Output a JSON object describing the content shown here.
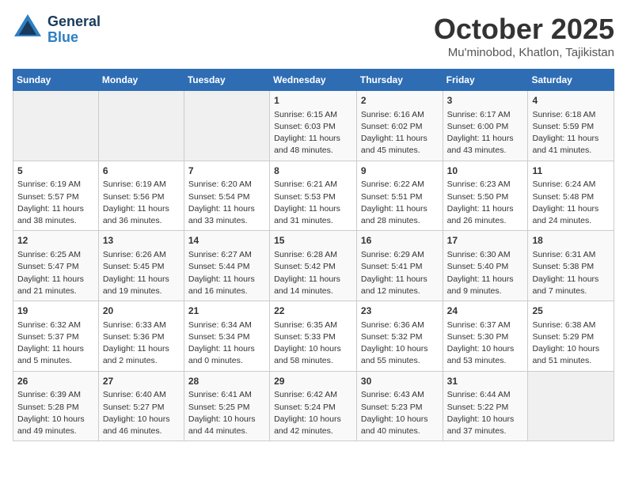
{
  "header": {
    "logo_line1": "General",
    "logo_line2": "Blue",
    "month": "October 2025",
    "location": "Mu'minobod, Khatlon, Tajikistan"
  },
  "days_of_week": [
    "Sunday",
    "Monday",
    "Tuesday",
    "Wednesday",
    "Thursday",
    "Friday",
    "Saturday"
  ],
  "weeks": [
    [
      {
        "day": "",
        "info": ""
      },
      {
        "day": "",
        "info": ""
      },
      {
        "day": "",
        "info": ""
      },
      {
        "day": "1",
        "info": "Sunrise: 6:15 AM\nSunset: 6:03 PM\nDaylight: 11 hours and 48 minutes."
      },
      {
        "day": "2",
        "info": "Sunrise: 6:16 AM\nSunset: 6:02 PM\nDaylight: 11 hours and 45 minutes."
      },
      {
        "day": "3",
        "info": "Sunrise: 6:17 AM\nSunset: 6:00 PM\nDaylight: 11 hours and 43 minutes."
      },
      {
        "day": "4",
        "info": "Sunrise: 6:18 AM\nSunset: 5:59 PM\nDaylight: 11 hours and 41 minutes."
      }
    ],
    [
      {
        "day": "5",
        "info": "Sunrise: 6:19 AM\nSunset: 5:57 PM\nDaylight: 11 hours and 38 minutes."
      },
      {
        "day": "6",
        "info": "Sunrise: 6:19 AM\nSunset: 5:56 PM\nDaylight: 11 hours and 36 minutes."
      },
      {
        "day": "7",
        "info": "Sunrise: 6:20 AM\nSunset: 5:54 PM\nDaylight: 11 hours and 33 minutes."
      },
      {
        "day": "8",
        "info": "Sunrise: 6:21 AM\nSunset: 5:53 PM\nDaylight: 11 hours and 31 minutes."
      },
      {
        "day": "9",
        "info": "Sunrise: 6:22 AM\nSunset: 5:51 PM\nDaylight: 11 hours and 28 minutes."
      },
      {
        "day": "10",
        "info": "Sunrise: 6:23 AM\nSunset: 5:50 PM\nDaylight: 11 hours and 26 minutes."
      },
      {
        "day": "11",
        "info": "Sunrise: 6:24 AM\nSunset: 5:48 PM\nDaylight: 11 hours and 24 minutes."
      }
    ],
    [
      {
        "day": "12",
        "info": "Sunrise: 6:25 AM\nSunset: 5:47 PM\nDaylight: 11 hours and 21 minutes."
      },
      {
        "day": "13",
        "info": "Sunrise: 6:26 AM\nSunset: 5:45 PM\nDaylight: 11 hours and 19 minutes."
      },
      {
        "day": "14",
        "info": "Sunrise: 6:27 AM\nSunset: 5:44 PM\nDaylight: 11 hours and 16 minutes."
      },
      {
        "day": "15",
        "info": "Sunrise: 6:28 AM\nSunset: 5:42 PM\nDaylight: 11 hours and 14 minutes."
      },
      {
        "day": "16",
        "info": "Sunrise: 6:29 AM\nSunset: 5:41 PM\nDaylight: 11 hours and 12 minutes."
      },
      {
        "day": "17",
        "info": "Sunrise: 6:30 AM\nSunset: 5:40 PM\nDaylight: 11 hours and 9 minutes."
      },
      {
        "day": "18",
        "info": "Sunrise: 6:31 AM\nSunset: 5:38 PM\nDaylight: 11 hours and 7 minutes."
      }
    ],
    [
      {
        "day": "19",
        "info": "Sunrise: 6:32 AM\nSunset: 5:37 PM\nDaylight: 11 hours and 5 minutes."
      },
      {
        "day": "20",
        "info": "Sunrise: 6:33 AM\nSunset: 5:36 PM\nDaylight: 11 hours and 2 minutes."
      },
      {
        "day": "21",
        "info": "Sunrise: 6:34 AM\nSunset: 5:34 PM\nDaylight: 11 hours and 0 minutes."
      },
      {
        "day": "22",
        "info": "Sunrise: 6:35 AM\nSunset: 5:33 PM\nDaylight: 10 hours and 58 minutes."
      },
      {
        "day": "23",
        "info": "Sunrise: 6:36 AM\nSunset: 5:32 PM\nDaylight: 10 hours and 55 minutes."
      },
      {
        "day": "24",
        "info": "Sunrise: 6:37 AM\nSunset: 5:30 PM\nDaylight: 10 hours and 53 minutes."
      },
      {
        "day": "25",
        "info": "Sunrise: 6:38 AM\nSunset: 5:29 PM\nDaylight: 10 hours and 51 minutes."
      }
    ],
    [
      {
        "day": "26",
        "info": "Sunrise: 6:39 AM\nSunset: 5:28 PM\nDaylight: 10 hours and 49 minutes."
      },
      {
        "day": "27",
        "info": "Sunrise: 6:40 AM\nSunset: 5:27 PM\nDaylight: 10 hours and 46 minutes."
      },
      {
        "day": "28",
        "info": "Sunrise: 6:41 AM\nSunset: 5:25 PM\nDaylight: 10 hours and 44 minutes."
      },
      {
        "day": "29",
        "info": "Sunrise: 6:42 AM\nSunset: 5:24 PM\nDaylight: 10 hours and 42 minutes."
      },
      {
        "day": "30",
        "info": "Sunrise: 6:43 AM\nSunset: 5:23 PM\nDaylight: 10 hours and 40 minutes."
      },
      {
        "day": "31",
        "info": "Sunrise: 6:44 AM\nSunset: 5:22 PM\nDaylight: 10 hours and 37 minutes."
      },
      {
        "day": "",
        "info": ""
      }
    ]
  ]
}
